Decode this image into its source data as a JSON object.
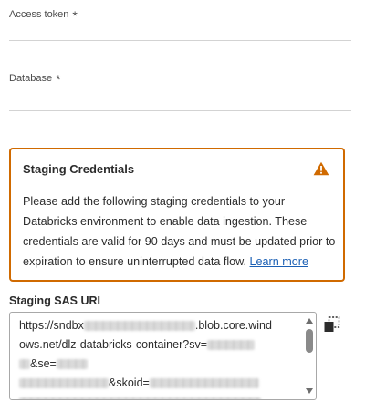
{
  "fields": {
    "access_token": {
      "label": "Access token",
      "required_mark": "*",
      "value": ""
    },
    "database": {
      "label": "Database",
      "required_mark": "*",
      "value": ""
    }
  },
  "alert": {
    "title": "Staging Credentials",
    "body": "Please add the following staging credentials to your Databricks environment to enable data ingestion. These credentials are valid for 90 days and must be updated prior to expiration to ensure uninterrupted data flow.",
    "link_label": "Learn more",
    "icon": "warning-icon",
    "accent_color": "#d06a00"
  },
  "sas_uri": {
    "label": "Staging SAS URI",
    "line1_prefix": "https://sndbx",
    "line1_suffix": ".blob.core.wind",
    "line2": "ows.net/dlz-databricks-container?sv=",
    "line3_mid": "&se=",
    "line4_mid": "&skoid=",
    "copy_icon": "copy-icon"
  },
  "colors": {
    "link": "#1a5fb4",
    "warning": "#d06a00"
  }
}
